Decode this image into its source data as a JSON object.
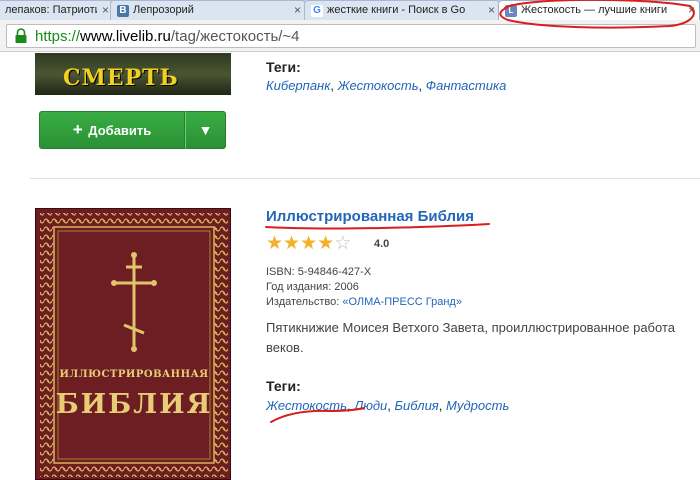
{
  "browser": {
    "tabs": [
      {
        "label": "лепаков: Патриоти",
        "favicon": ""
      },
      {
        "label": "Лепрозорий",
        "favicon": "В"
      },
      {
        "label": "жесткие книги - Поиск в Go",
        "favicon": "G"
      },
      {
        "label": "Жестокость — лучшие книги",
        "favicon": "L"
      }
    ],
    "tab_close": "×",
    "url": {
      "scheme": "https://",
      "host": "www.livelib.ru",
      "path": "/tag/жестокость/~4"
    }
  },
  "top_item": {
    "cover_text": "СМЕРТЬ",
    "tags_title": "Теги:",
    "tags": [
      "Киберпанк",
      "Жестокость",
      "Фантастика"
    ],
    "add_button": {
      "plus": "+",
      "label": "Добавить"
    },
    "dropdown_icon": "▼"
  },
  "book": {
    "title": "Иллюстрированная Библия",
    "cover_line1": "ИЛЛЮСТРИРОВАННАЯ",
    "cover_line2": "БИБЛИЯ",
    "stars": 4,
    "stars_total": 5,
    "rating": "4.0",
    "isbn": "ISBN: 5-94846-427-X",
    "year": "Год издания: 2006",
    "publisher_label": "Издательство:",
    "publisher": "«ОЛМА-ПРЕСС Гранд»",
    "description_line1": "Пятикнижие Моисея Ветхого Завета, проиллюстрированное работа",
    "description_line2": "веков.",
    "tags_title": "Теги:",
    "tags": [
      "Жестокость",
      "Люди",
      "Библия",
      "Мудрость"
    ]
  },
  "colors": {
    "link": "#2166b8",
    "button_green": "#2a9135",
    "star": "#f3b02a",
    "cover": "#6d1e22",
    "annotation_ink": "#d81e1e"
  }
}
